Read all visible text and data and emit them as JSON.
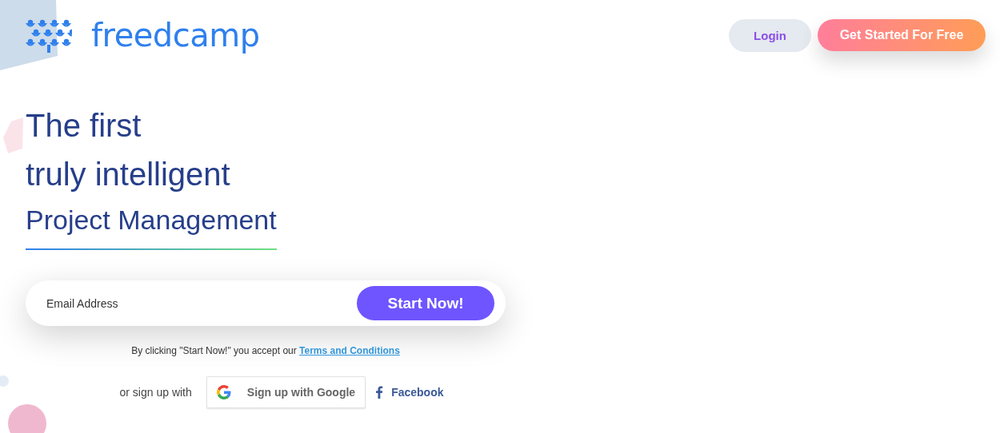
{
  "header": {
    "brand": "freedcamp",
    "login": "Login",
    "cta": "Get Started For Free"
  },
  "hero": {
    "lines": [
      "The first",
      "truly intelligent"
    ],
    "highlight": "Project Management"
  },
  "signup": {
    "email_placeholder": "Email Address",
    "button": "Start Now!",
    "terms_prefix": "By clicking \"Start Now!\" you accept our",
    "terms_link": "Terms and Conditions"
  },
  "social": {
    "prefix": "or sign up with",
    "google": "Sign up with Google",
    "facebook": "Facebook"
  }
}
